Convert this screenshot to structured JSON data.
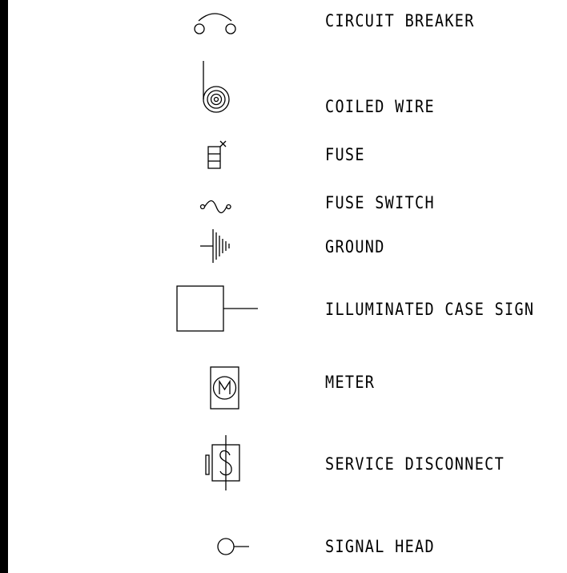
{
  "legend": {
    "items": [
      {
        "key": "circuit_breaker",
        "label": "CIRCUIT BREAKER",
        "icon": "circuit-breaker-icon"
      },
      {
        "key": "coiled_wire",
        "label": "COILED WIRE",
        "icon": "coiled-wire-icon"
      },
      {
        "key": "fuse",
        "label": "FUSE",
        "icon": "fuse-icon"
      },
      {
        "key": "fuse_switch",
        "label": "FUSE SWITCH",
        "icon": "fuse-switch-icon"
      },
      {
        "key": "ground",
        "label": "GROUND",
        "icon": "ground-icon"
      },
      {
        "key": "illuminated_case_sign",
        "label": "ILLUMINATED CASE SIGN",
        "icon": "illuminated-case-sign-icon"
      },
      {
        "key": "meter",
        "label": "METER",
        "icon": "meter-icon"
      },
      {
        "key": "service_disconnect",
        "label": "SERVICE DISCONNECT",
        "icon": "service-disconnect-icon"
      },
      {
        "key": "signal_head",
        "label": "SIGNAL HEAD",
        "icon": "signal-head-icon"
      }
    ]
  },
  "colors": {
    "line": "#000000",
    "background": "#ffffff"
  }
}
